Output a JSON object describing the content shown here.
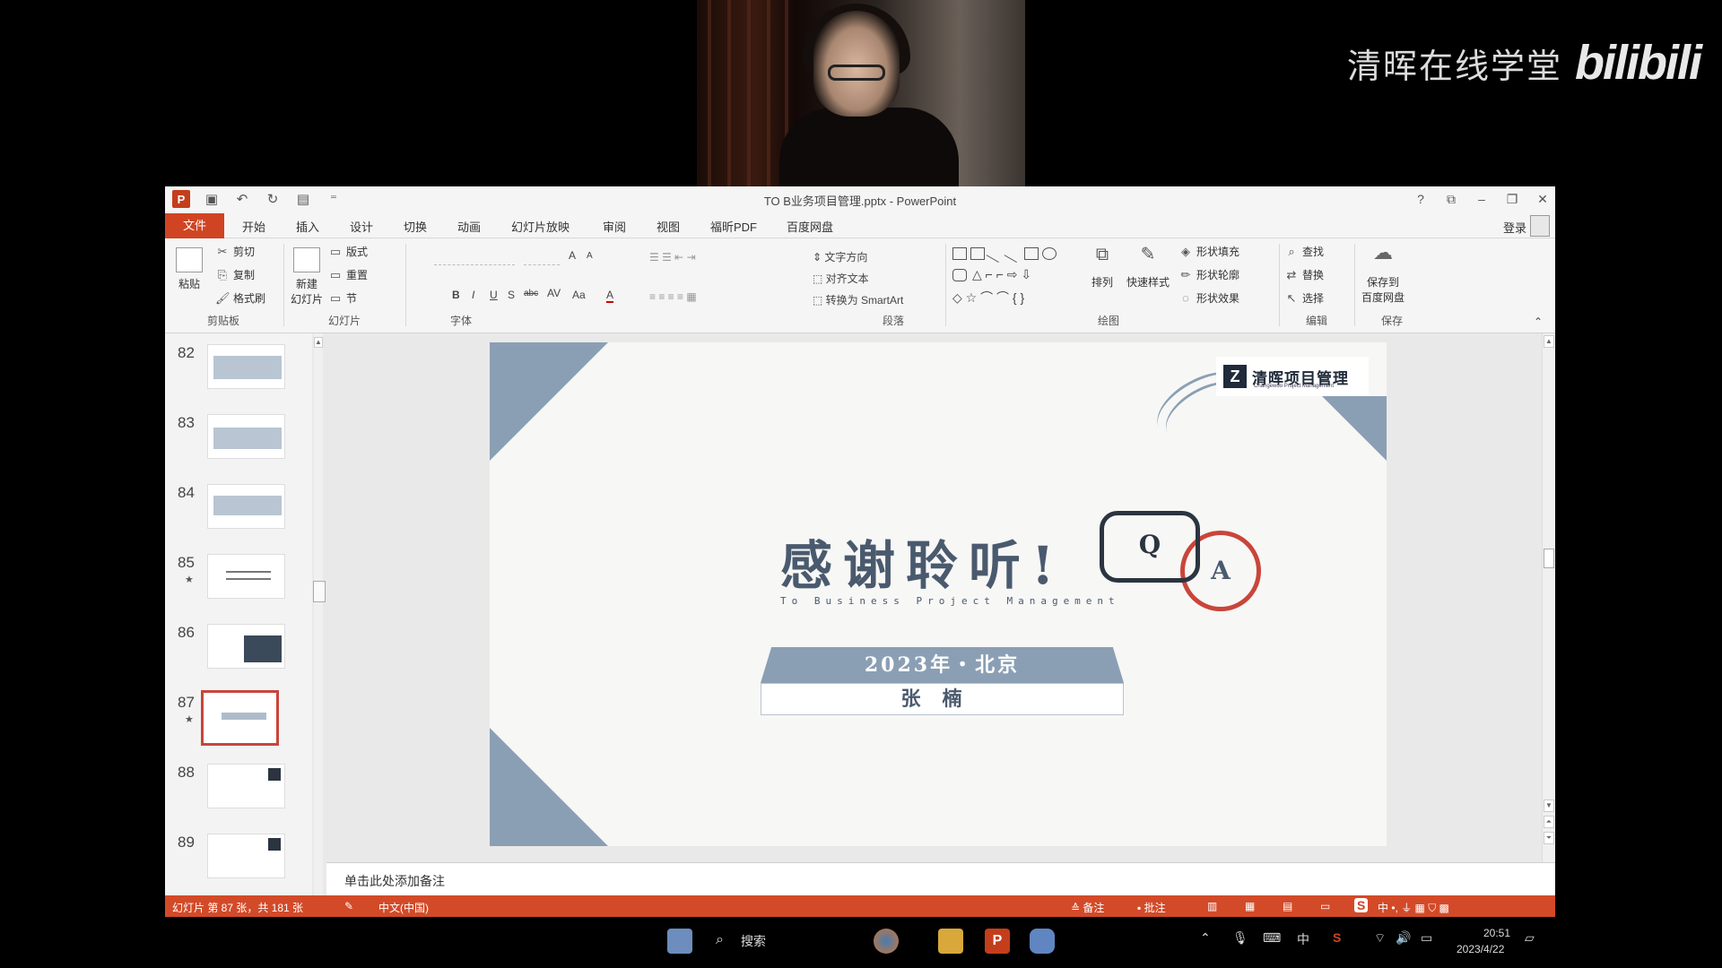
{
  "watermark": {
    "text": "清晖在线学堂",
    "logo": "bilibili"
  },
  "window": {
    "title": "TO B业务项目管理.pptx - PowerPoint",
    "controls": {
      "help": "?",
      "restore_ribbon": "⧉",
      "minimize": "–",
      "maximize": "❐",
      "close": "✕"
    }
  },
  "menu": {
    "tabs": [
      "文件",
      "开始",
      "插入",
      "设计",
      "切换",
      "动画",
      "幻灯片放映",
      "审阅",
      "视图",
      "福昕PDF",
      "百度网盘"
    ],
    "signin": "登录"
  },
  "ribbon": {
    "clipboard": {
      "paste": "粘贴",
      "cut": "剪切",
      "copy": "复制",
      "format_painter": "格式刷",
      "label": "剪贴板"
    },
    "slides": {
      "new_slide": "新建\n幻灯片",
      "layout": "版式",
      "reset": "重置",
      "section": "节",
      "label": "幻灯片"
    },
    "font": {
      "label": "字体",
      "bold": "B",
      "italic": "I",
      "underline": "U",
      "shadow": "S",
      "strike": "abc",
      "spacing": "AV",
      "case": "Aa",
      "color": "A",
      "grow": "A",
      "shrink": "A"
    },
    "paragraph": {
      "label": "段落",
      "text_direction": "文字方向",
      "align_text": "对齐文本",
      "smartart": "转换为 SmartArt"
    },
    "drawing": {
      "label": "绘图",
      "arrange": "排列",
      "quick_styles": "快速样式",
      "fill": "形状填充",
      "outline": "形状轮廓",
      "effects": "形状效果"
    },
    "editing": {
      "label": "编辑",
      "find": "查找",
      "replace": "替换",
      "select": "选择"
    },
    "save": {
      "label": "保存",
      "save_baidu": "保存到\n百度网盘"
    }
  },
  "thumbnails": [
    {
      "num": "82",
      "star": ""
    },
    {
      "num": "83",
      "star": ""
    },
    {
      "num": "84",
      "star": ""
    },
    {
      "num": "85",
      "star": "★"
    },
    {
      "num": "86",
      "star": ""
    },
    {
      "num": "87",
      "star": "★",
      "selected": true
    },
    {
      "num": "88",
      "star": ""
    },
    {
      "num": "89",
      "star": ""
    }
  ],
  "slide": {
    "logo_text": "清晖项目管理",
    "logo_sub": "Changewoo Project Management",
    "title": "感谢聆听!",
    "subtitle": "To Business Project Management",
    "bubble_q": "Q",
    "bubble_a": "A",
    "date_line": "2023年・北京",
    "presenter": "张楠"
  },
  "notes": {
    "placeholder": "单击此处添加备注"
  },
  "status": {
    "slide_info": "幻灯片 第 87 张，共 181 张",
    "language": "中文(中国)",
    "notes": "备注",
    "comments": "批注"
  },
  "taskbar": {
    "search": "搜索",
    "ime": "中",
    "time": "20:51",
    "date": "2023/4/22"
  },
  "colors": {
    "accent": "#d04423",
    "slide_gray": "#8b9fb4",
    "dark": "#2b3440",
    "red": "#c9453a"
  }
}
